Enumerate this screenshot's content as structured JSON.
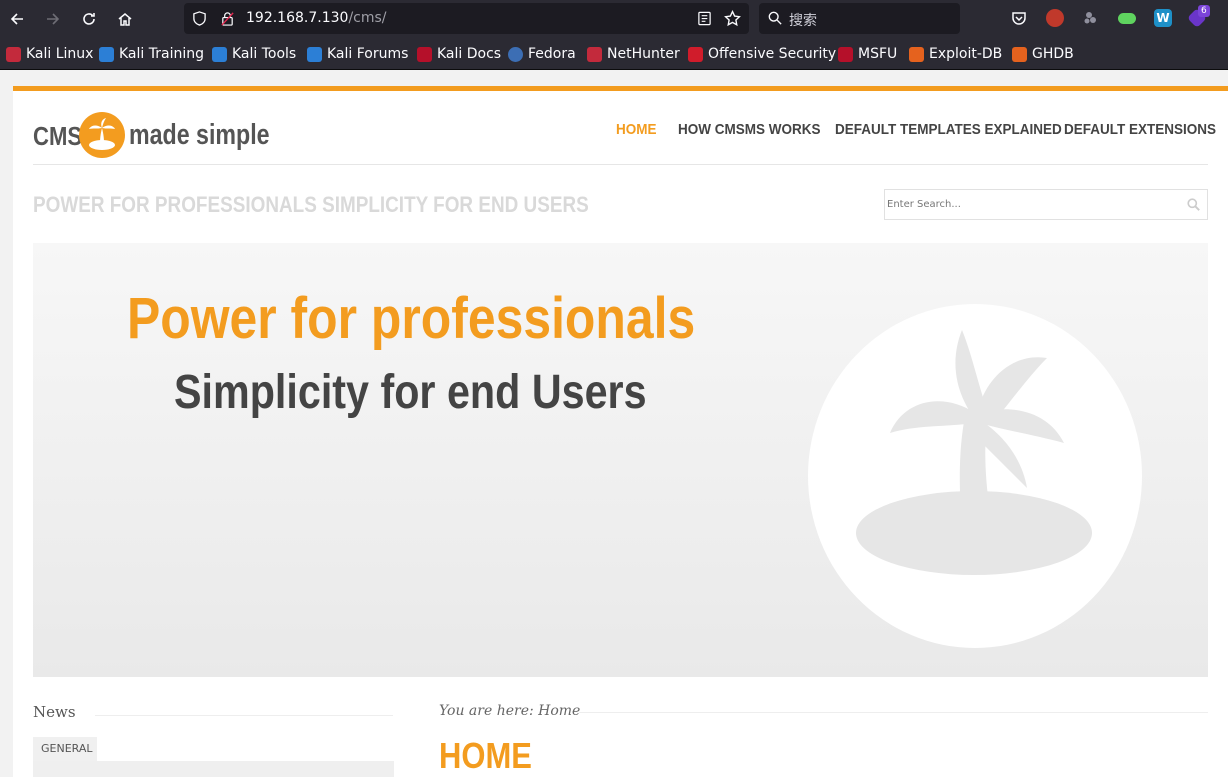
{
  "browser": {
    "url_host": "192.168.7.130",
    "url_path": "/cms/",
    "search_placeholder": "搜索",
    "bookmarks": [
      {
        "label": "Kali Linux",
        "icon": "kali-icon"
      },
      {
        "label": "Kali Training",
        "icon": "kali-training-icon"
      },
      {
        "label": "Kali Tools",
        "icon": "kali-tools-icon"
      },
      {
        "label": "Kali Forums",
        "icon": "kali-forums-icon"
      },
      {
        "label": "Kali Docs",
        "icon": "kali-docs-icon"
      },
      {
        "label": "Fedora",
        "icon": "fedora-icon"
      },
      {
        "label": "NetHunter",
        "icon": "nethunter-icon"
      },
      {
        "label": "Offensive Security",
        "icon": "offsec-icon"
      },
      {
        "label": "MSFU",
        "icon": "msfu-icon"
      },
      {
        "label": "Exploit-DB",
        "icon": "exploitdb-icon"
      },
      {
        "label": "GHDB",
        "icon": "ghdb-icon"
      }
    ],
    "extension_badge": "6"
  },
  "site": {
    "logo_text_left": "CMS",
    "logo_text_right": "made simple",
    "nav": [
      "HOME",
      "HOW CMSMS WORKS",
      "DEFAULT TEMPLATES EXPLAINED",
      "DEFAULT EXTENSIONS"
    ],
    "tagline": "POWER FOR PROFESSIONALS SIMPLICITY FOR END USERS",
    "search_placeholder": "Enter Search...",
    "banner_line1": "Power for professionals",
    "banner_line2": "Simplicity for end Users",
    "news_title": "News",
    "news_tab": "GENERAL",
    "breadcrumb": "You are here: Home",
    "page_title": "HOME"
  },
  "colors": {
    "accent": "#f39c1f",
    "toolbar": "#2b2a33",
    "text_dark": "#444444"
  }
}
